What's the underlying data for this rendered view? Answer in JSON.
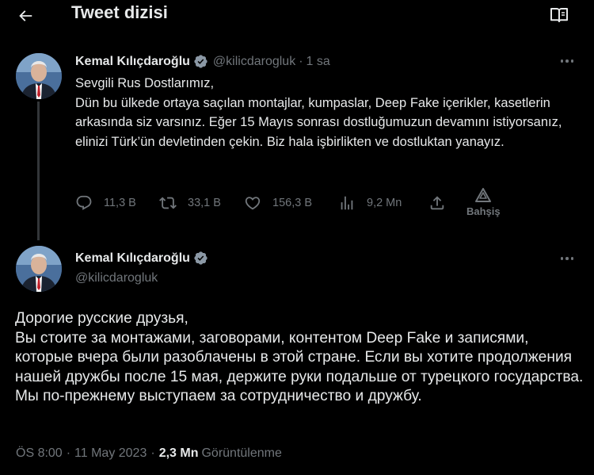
{
  "header": {
    "title": "Tweet dizisi",
    "back_icon": "arrow-left-icon",
    "reader_icon": "book-open-icon"
  },
  "tweet1": {
    "name": "Kemal Kılıçdaroğlu",
    "handle": "@kilicdarogluk",
    "separator": "·",
    "time": "1 sa",
    "lines": [
      "Sevgili Rus Dostlarımız,",
      "Dün bu ülkede ortaya saçılan montajlar, kumpaslar, Deep Fake içerikler, kasetlerin arkasında siz varsınız. Eğer 15 Mayıs sonrası dostluğumuzun devamını istiyorsanız, elinizi Türk’ün devletinden çekin. Biz hala işbirlikten ve dostluktan yanayız."
    ],
    "actions": {
      "replies": "11,3 B",
      "retweets": "33,1 B",
      "likes": "156,3 B",
      "views": "9,2 Mn",
      "tip_label": "Bahşiş"
    }
  },
  "tweet2": {
    "name": "Kemal Kılıçdaroğlu",
    "handle": "@kilicdarogluk",
    "lines": [
      "Дорогие русские друзья,",
      "Вы стоите за монтажами, заговорами, контентом Deep Fake и записями, которые вчера были разоблачены в этой стране. Если вы хотите продолжения нашей дружбы после 15 мая, держите руки подальше от турецкого государства. Мы по-прежнему выступаем за сотрудничество и дружбу."
    ],
    "meta": {
      "time": "ÖS 8:00",
      "separator": "·",
      "date": "11 May 2023",
      "separator2": "·",
      "views_count": "2,3 Mn",
      "views_label": "Görüntülenme"
    }
  },
  "colors": {
    "background": "#000000",
    "text": "#e7e9ea",
    "muted": "#71767b",
    "verified": "#8b98a5",
    "thread_line": "#333639"
  }
}
